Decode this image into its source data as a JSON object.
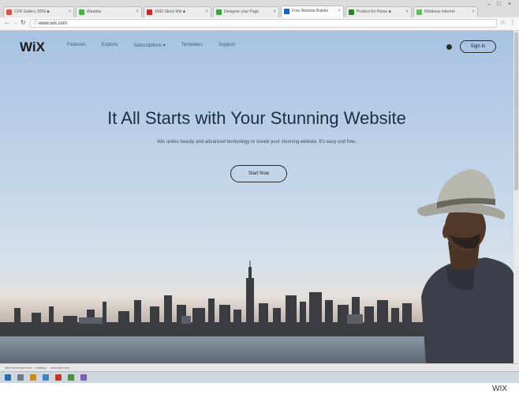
{
  "browser": {
    "tabs": [
      {
        "label": "CFR Gallery 2009 ■"
      },
      {
        "label": "Weather"
      },
      {
        "label": "1990 Stock Mkt ■"
      },
      {
        "label": "Designer your Page"
      },
      {
        "label": "Free Website Builder"
      },
      {
        "label": "Product for Home ■"
      },
      {
        "label": "Windows Internet"
      }
    ],
    "url": "www.wix.com"
  },
  "site": {
    "logo": "WiX",
    "nav": [
      "Features",
      "Explore",
      "Subscriptions ▾",
      "Templates",
      "Support"
    ],
    "signin_label": "Sign In",
    "headline": "It All Starts with Your Stunning Website",
    "subheadline": "Wix unites beauty and advanced technology to create your stunning website. It's easy and free.",
    "cta_label": "Start Now"
  },
  "status_text": "http://www.wix.com ... loading ... www.wix.com",
  "footer_label": "WIX",
  "colors": {
    "sky_top": "#a7c2e2",
    "headline": "#1f2d44",
    "logo": "#1c1c1c"
  }
}
